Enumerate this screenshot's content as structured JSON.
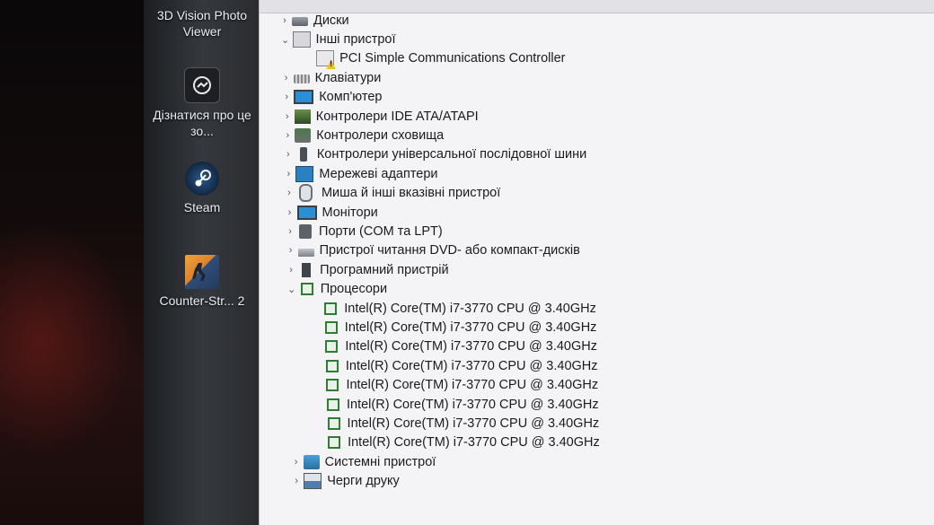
{
  "desktop": {
    "icons": [
      {
        "label": "3D Vision Photo Viewer",
        "icon": "3d-vision-icon"
      },
      {
        "label": "Дізнатися про це зо...",
        "icon": "about-icon"
      },
      {
        "label": "Steam",
        "icon": "steam-icon"
      },
      {
        "label": "Counter-Str... 2",
        "icon": "counter-strike-icon"
      }
    ]
  },
  "device_tree": [
    {
      "label": "Диски",
      "expanded": false,
      "icon": "disk-drive-icon"
    },
    {
      "label": "Інші пристрої",
      "expanded": true,
      "icon": "other-devices-icon"
    },
    {
      "label": "PCI Simple Communications Controller",
      "child": true,
      "icon": "warning-device-icon"
    },
    {
      "label": "Клавіатури",
      "expanded": false,
      "icon": "keyboard-icon"
    },
    {
      "label": "Комп'ютер",
      "expanded": false,
      "icon": "computer-icon"
    },
    {
      "label": "Контролери IDE ATA/ATAPI",
      "expanded": false,
      "icon": "ide-controller-icon"
    },
    {
      "label": "Контролери сховища",
      "expanded": false,
      "icon": "storage-controller-icon"
    },
    {
      "label": "Контролери універсальної послідовної шини",
      "expanded": false,
      "icon": "usb-icon"
    },
    {
      "label": "Мережеві адаптери",
      "expanded": false,
      "icon": "network-adapter-icon"
    },
    {
      "label": "Миша й інші вказівні пристрої",
      "expanded": false,
      "icon": "mouse-icon"
    },
    {
      "label": "Монітори",
      "expanded": false,
      "icon": "monitor-icon"
    },
    {
      "label": "Порти (COM та LPT)",
      "expanded": false,
      "icon": "port-icon"
    },
    {
      "label": "Пристрої читання DVD- або компакт-дисків",
      "expanded": false,
      "icon": "dvd-drive-icon"
    },
    {
      "label": "Програмний пристрій",
      "expanded": false,
      "icon": "software-device-icon"
    },
    {
      "label": "Процесори",
      "expanded": true,
      "icon": "processor-icon"
    },
    {
      "label": "Intel(R) Core(TM) i7-3770 CPU @ 3.40GHz",
      "child": true,
      "icon": "processor-icon"
    },
    {
      "label": "Intel(R) Core(TM) i7-3770 CPU @ 3.40GHz",
      "child": true,
      "icon": "processor-icon"
    },
    {
      "label": "Intel(R) Core(TM) i7-3770 CPU @ 3.40GHz",
      "child": true,
      "icon": "processor-icon"
    },
    {
      "label": "Intel(R) Core(TM) i7-3770 CPU @ 3.40GHz",
      "child": true,
      "icon": "processor-icon"
    },
    {
      "label": "Intel(R) Core(TM) i7-3770 CPU @ 3.40GHz",
      "child": true,
      "icon": "processor-icon"
    },
    {
      "label": "Intel(R) Core(TM) i7-3770 CPU @ 3.40GHz",
      "child": true,
      "icon": "processor-icon"
    },
    {
      "label": "Intel(R) Core(TM) i7-3770 CPU @ 3.40GHz",
      "child": true,
      "icon": "processor-icon"
    },
    {
      "label": "Intel(R) Core(TM) i7-3770 CPU @ 3.40GHz",
      "child": true,
      "icon": "processor-icon"
    },
    {
      "label": "Системні пристрої",
      "expanded": false,
      "icon": "system-devices-icon"
    },
    {
      "label": "Черги друку",
      "expanded": false,
      "icon": "print-queue-icon"
    }
  ],
  "glyphs": {
    "collapsed": "›",
    "expanded": "⌄"
  }
}
